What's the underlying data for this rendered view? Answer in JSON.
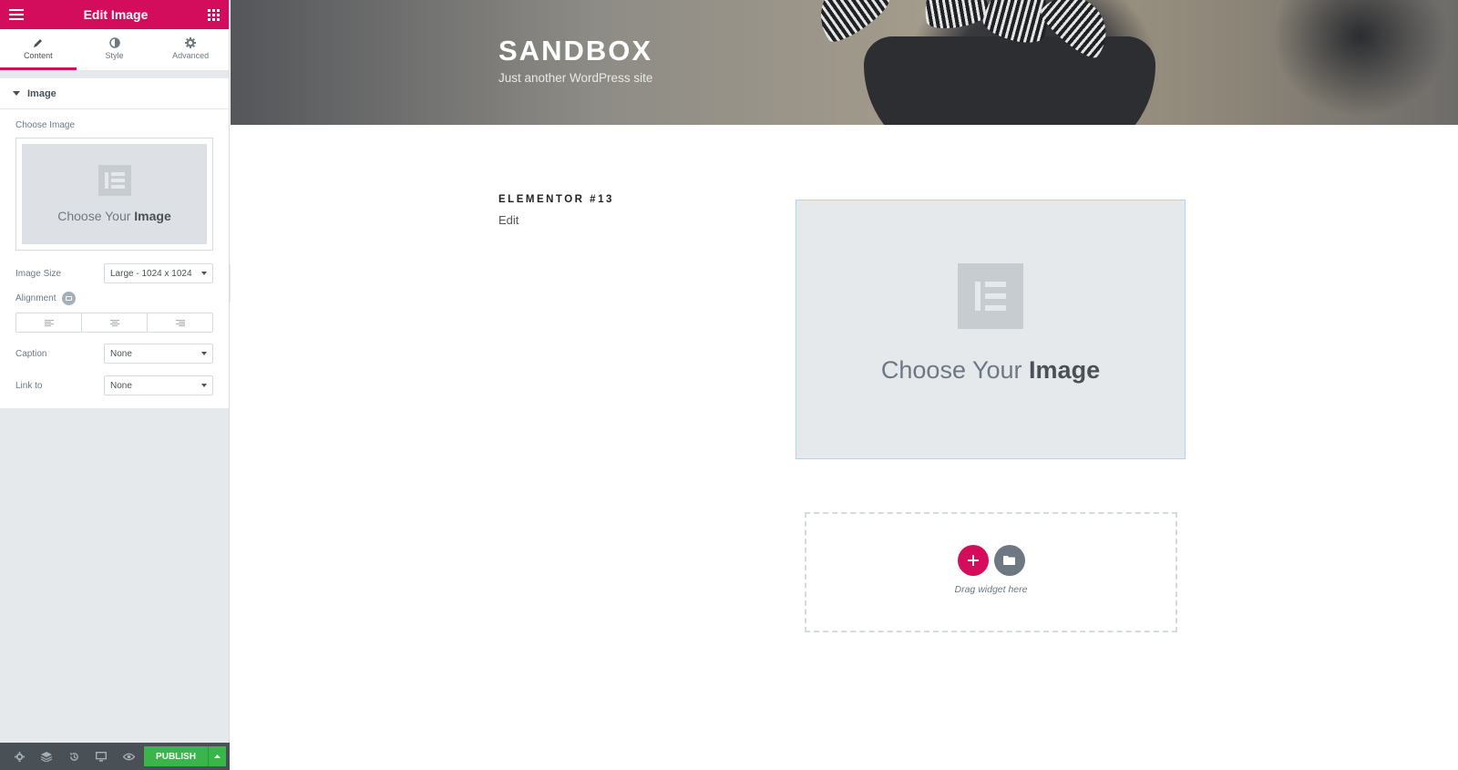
{
  "panel": {
    "title": "Edit Image",
    "tabs": [
      {
        "label": "Content",
        "icon": "pencil-icon",
        "active": true
      },
      {
        "label": "Style",
        "icon": "contrast-icon",
        "active": false
      },
      {
        "label": "Advanced",
        "icon": "gear-icon",
        "active": false
      }
    ],
    "section_title": "Image",
    "choose_image_label": "Choose Image",
    "placeholder": {
      "prefix": "Choose Your",
      "bold": "Image"
    },
    "image_size": {
      "label": "Image Size",
      "value": "Large - 1024 x 1024"
    },
    "alignment": {
      "label": "Alignment",
      "options": [
        "left",
        "center",
        "right"
      ]
    },
    "caption": {
      "label": "Caption",
      "value": "None"
    },
    "link_to": {
      "label": "Link to",
      "value": "None"
    },
    "footer": {
      "publish_label": "PUBLISH",
      "icons": [
        "gear-icon",
        "layers-icon",
        "history-icon",
        "responsive-icon",
        "eye-icon"
      ]
    }
  },
  "preview": {
    "site_title": "SANDBOX",
    "site_description": "Just another WordPress site",
    "post_title": "ELEMENTOR #13",
    "edit_link": "Edit",
    "image_placeholder": {
      "prefix": "Choose Your",
      "bold": "Image"
    },
    "dropzone_text": "Drag widget here"
  },
  "colors": {
    "accent": "#d30c5c",
    "publish": "#39b54a",
    "panel_bg": "#e6e9ec",
    "footer_bg": "#495157"
  }
}
